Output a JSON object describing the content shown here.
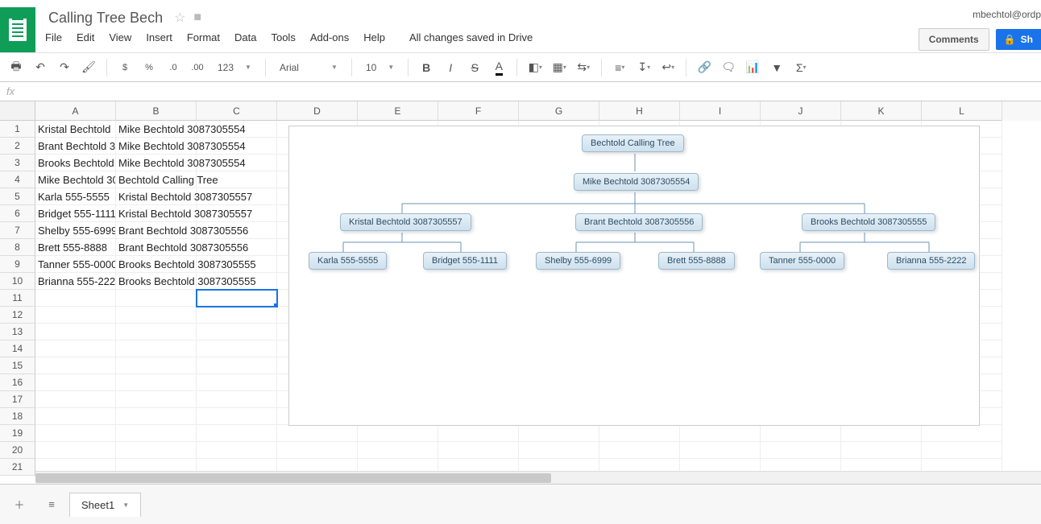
{
  "doc": {
    "title": "Calling Tree Bech",
    "save_status": "All changes saved in Drive",
    "user_email": "mbechtol@ordp"
  },
  "menus": [
    "File",
    "Edit",
    "View",
    "Insert",
    "Format",
    "Data",
    "Tools",
    "Add-ons",
    "Help"
  ],
  "header_buttons": {
    "comments": "Comments",
    "share": "Sh"
  },
  "toolbar": {
    "currency": "$",
    "percent": "%",
    "dec_dec": ".0",
    "dec_inc": ".00",
    "format_more": "123",
    "font": "Arial",
    "font_size": "10"
  },
  "formula_bar": {
    "fx": "fx"
  },
  "columns": [
    "A",
    "B",
    "C",
    "D",
    "E",
    "F",
    "G",
    "H",
    "I",
    "J",
    "K",
    "L"
  ],
  "row_count": 21,
  "selected_cell": {
    "row": 11,
    "col": "C"
  },
  "cells": {
    "A1": "Kristal Bechtold",
    "B1": "Mike Bechtold 3087305554",
    "A2": "Brant Bechtold 3",
    "B2": "Mike Bechtold 3087305554",
    "A3": "Brooks Bechtold",
    "B3": "Mike Bechtold 3087305554",
    "A4": "Mike Bechtold 30",
    "B4": "Bechtold Calling Tree",
    "A5": "Karla 555-5555",
    "B5": "Kristal Bechtold 3087305557",
    "A6": "Bridget 555-1111",
    "B6": "Kristal Bechtold 3087305557",
    "A7": "Shelby 555-6999",
    "B7": "Brant Bechtold 3087305556",
    "A8": "Brett 555-8888",
    "B8": "Brant Bechtold 3087305556",
    "A9": "Tanner 555-0000",
    "B9": "Brooks Bechtold 3087305555",
    "A10": "Brianna 555-222",
    "B10": "Brooks Bechtold 3087305555"
  },
  "chart_data": {
    "type": "org",
    "root": "Bechtold Calling Tree",
    "nodes": {
      "root": "Bechtold Calling Tree",
      "mike": "Mike Bechtold 3087305554",
      "kristal": "Kristal Bechtold 3087305557",
      "brant": "Brant Bechtold 3087305556",
      "brooks": "Brooks Bechtold 3087305555",
      "karla": "Karla 555-5555",
      "bridget": "Bridget 555-1111",
      "shelby": "Shelby 555-6999",
      "brett": "Brett 555-8888",
      "tanner": "Tanner 555-0000",
      "brianna": "Brianna 555-2222"
    },
    "edges": [
      [
        "root",
        "mike"
      ],
      [
        "mike",
        "kristal"
      ],
      [
        "mike",
        "brant"
      ],
      [
        "mike",
        "brooks"
      ],
      [
        "kristal",
        "karla"
      ],
      [
        "kristal",
        "bridget"
      ],
      [
        "brant",
        "shelby"
      ],
      [
        "brant",
        "brett"
      ],
      [
        "brooks",
        "tanner"
      ],
      [
        "brooks",
        "brianna"
      ]
    ]
  },
  "sheet_tab": "Sheet1"
}
